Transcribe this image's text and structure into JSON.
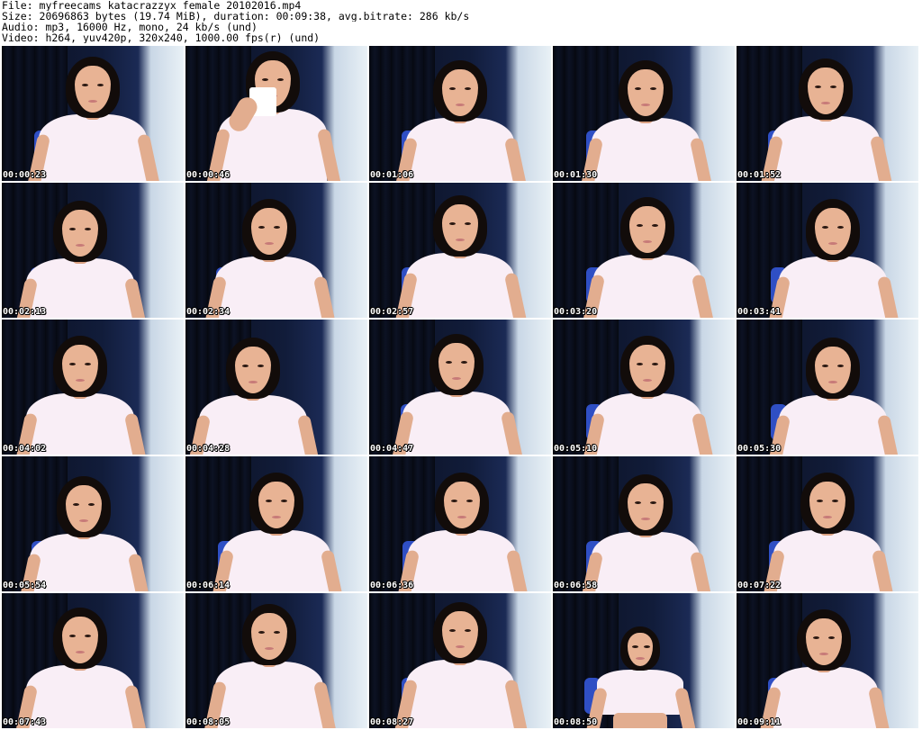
{
  "header": {
    "file": "File: myfreecams_katacrazzyx_female_20102016.mp4",
    "size": "Size: 20696863 bytes (19.74 MiB), duration: 00:09:38, avg.bitrate: 286 kb/s",
    "audio": "Audio: mp3, 16000 Hz, mono, 24 kb/s (und)",
    "video": "Video: h264, yuv420p, 320x240, 1000.00 fps(r) (und)"
  },
  "colors": {
    "background": "#ffffff",
    "shirt": "#f9eef6",
    "chair": "#2f4fc4",
    "wall_light": "#e9f1f6",
    "curtain_dark": "#0b0f1e",
    "timestamp_text": "#ffffff"
  },
  "thumbnails": [
    {
      "timestamp": "00:00:23"
    },
    {
      "timestamp": "00:00:46"
    },
    {
      "timestamp": "00:01:06"
    },
    {
      "timestamp": "00:01:30"
    },
    {
      "timestamp": "00:01:52"
    },
    {
      "timestamp": "00:02:13"
    },
    {
      "timestamp": "00:02:34"
    },
    {
      "timestamp": "00:02:57"
    },
    {
      "timestamp": "00:03:20"
    },
    {
      "timestamp": "00:03:41"
    },
    {
      "timestamp": "00:04:02"
    },
    {
      "timestamp": "00:04:28"
    },
    {
      "timestamp": "00:04:47"
    },
    {
      "timestamp": "00:05:10"
    },
    {
      "timestamp": "00:05:30"
    },
    {
      "timestamp": "00:05:54"
    },
    {
      "timestamp": "00:06:14"
    },
    {
      "timestamp": "00:06:36"
    },
    {
      "timestamp": "00:06:58"
    },
    {
      "timestamp": "00:07:22"
    },
    {
      "timestamp": "00:07:43"
    },
    {
      "timestamp": "00:08:05"
    },
    {
      "timestamp": "00:08:27"
    },
    {
      "timestamp": "00:08:50"
    },
    {
      "timestamp": "00:09:11"
    }
  ]
}
